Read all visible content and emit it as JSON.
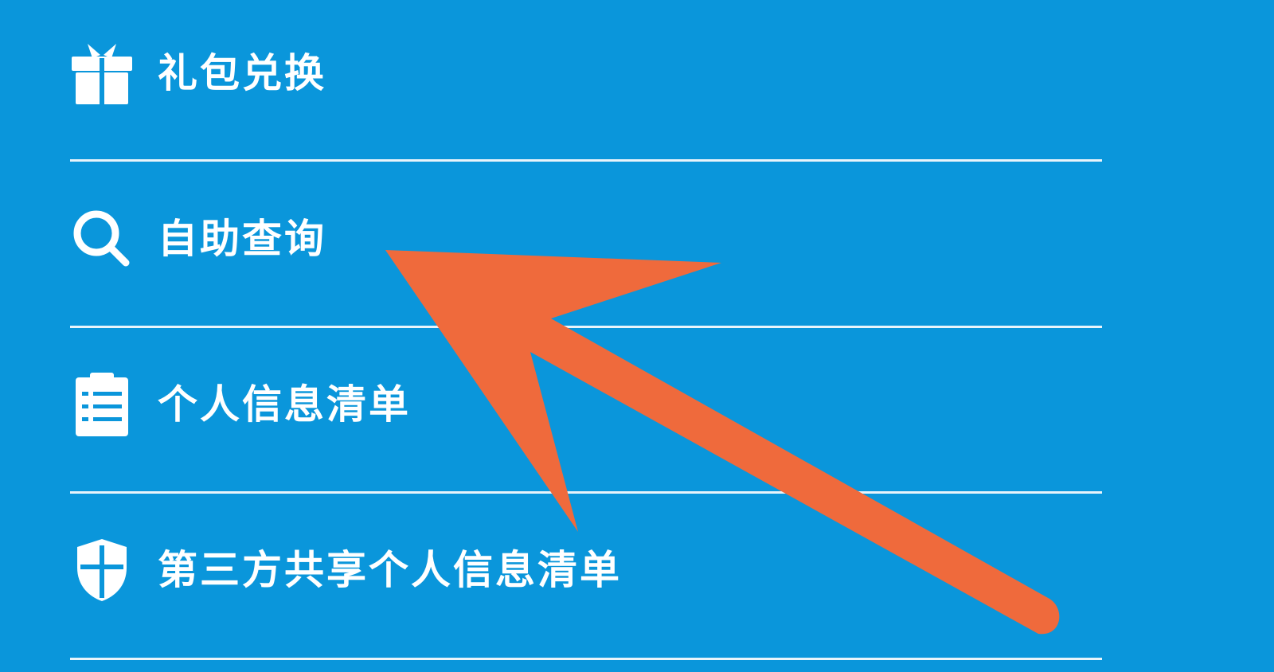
{
  "menu": {
    "items": [
      {
        "label": "礼包兑换",
        "icon": "gift-icon"
      },
      {
        "label": "自助查询",
        "icon": "search-icon"
      },
      {
        "label": "个人信息清单",
        "icon": "clipboard-list-icon"
      },
      {
        "label": "第三方共享个人信息清单",
        "icon": "shield-icon"
      }
    ]
  },
  "annotation": {
    "type": "arrow",
    "color": "#ef6a3c",
    "points_to": "自助查询"
  },
  "colors": {
    "background": "#0a96db",
    "text": "#ffffff",
    "divider": "#e8f4fb",
    "arrow": "#ef6a3c"
  }
}
